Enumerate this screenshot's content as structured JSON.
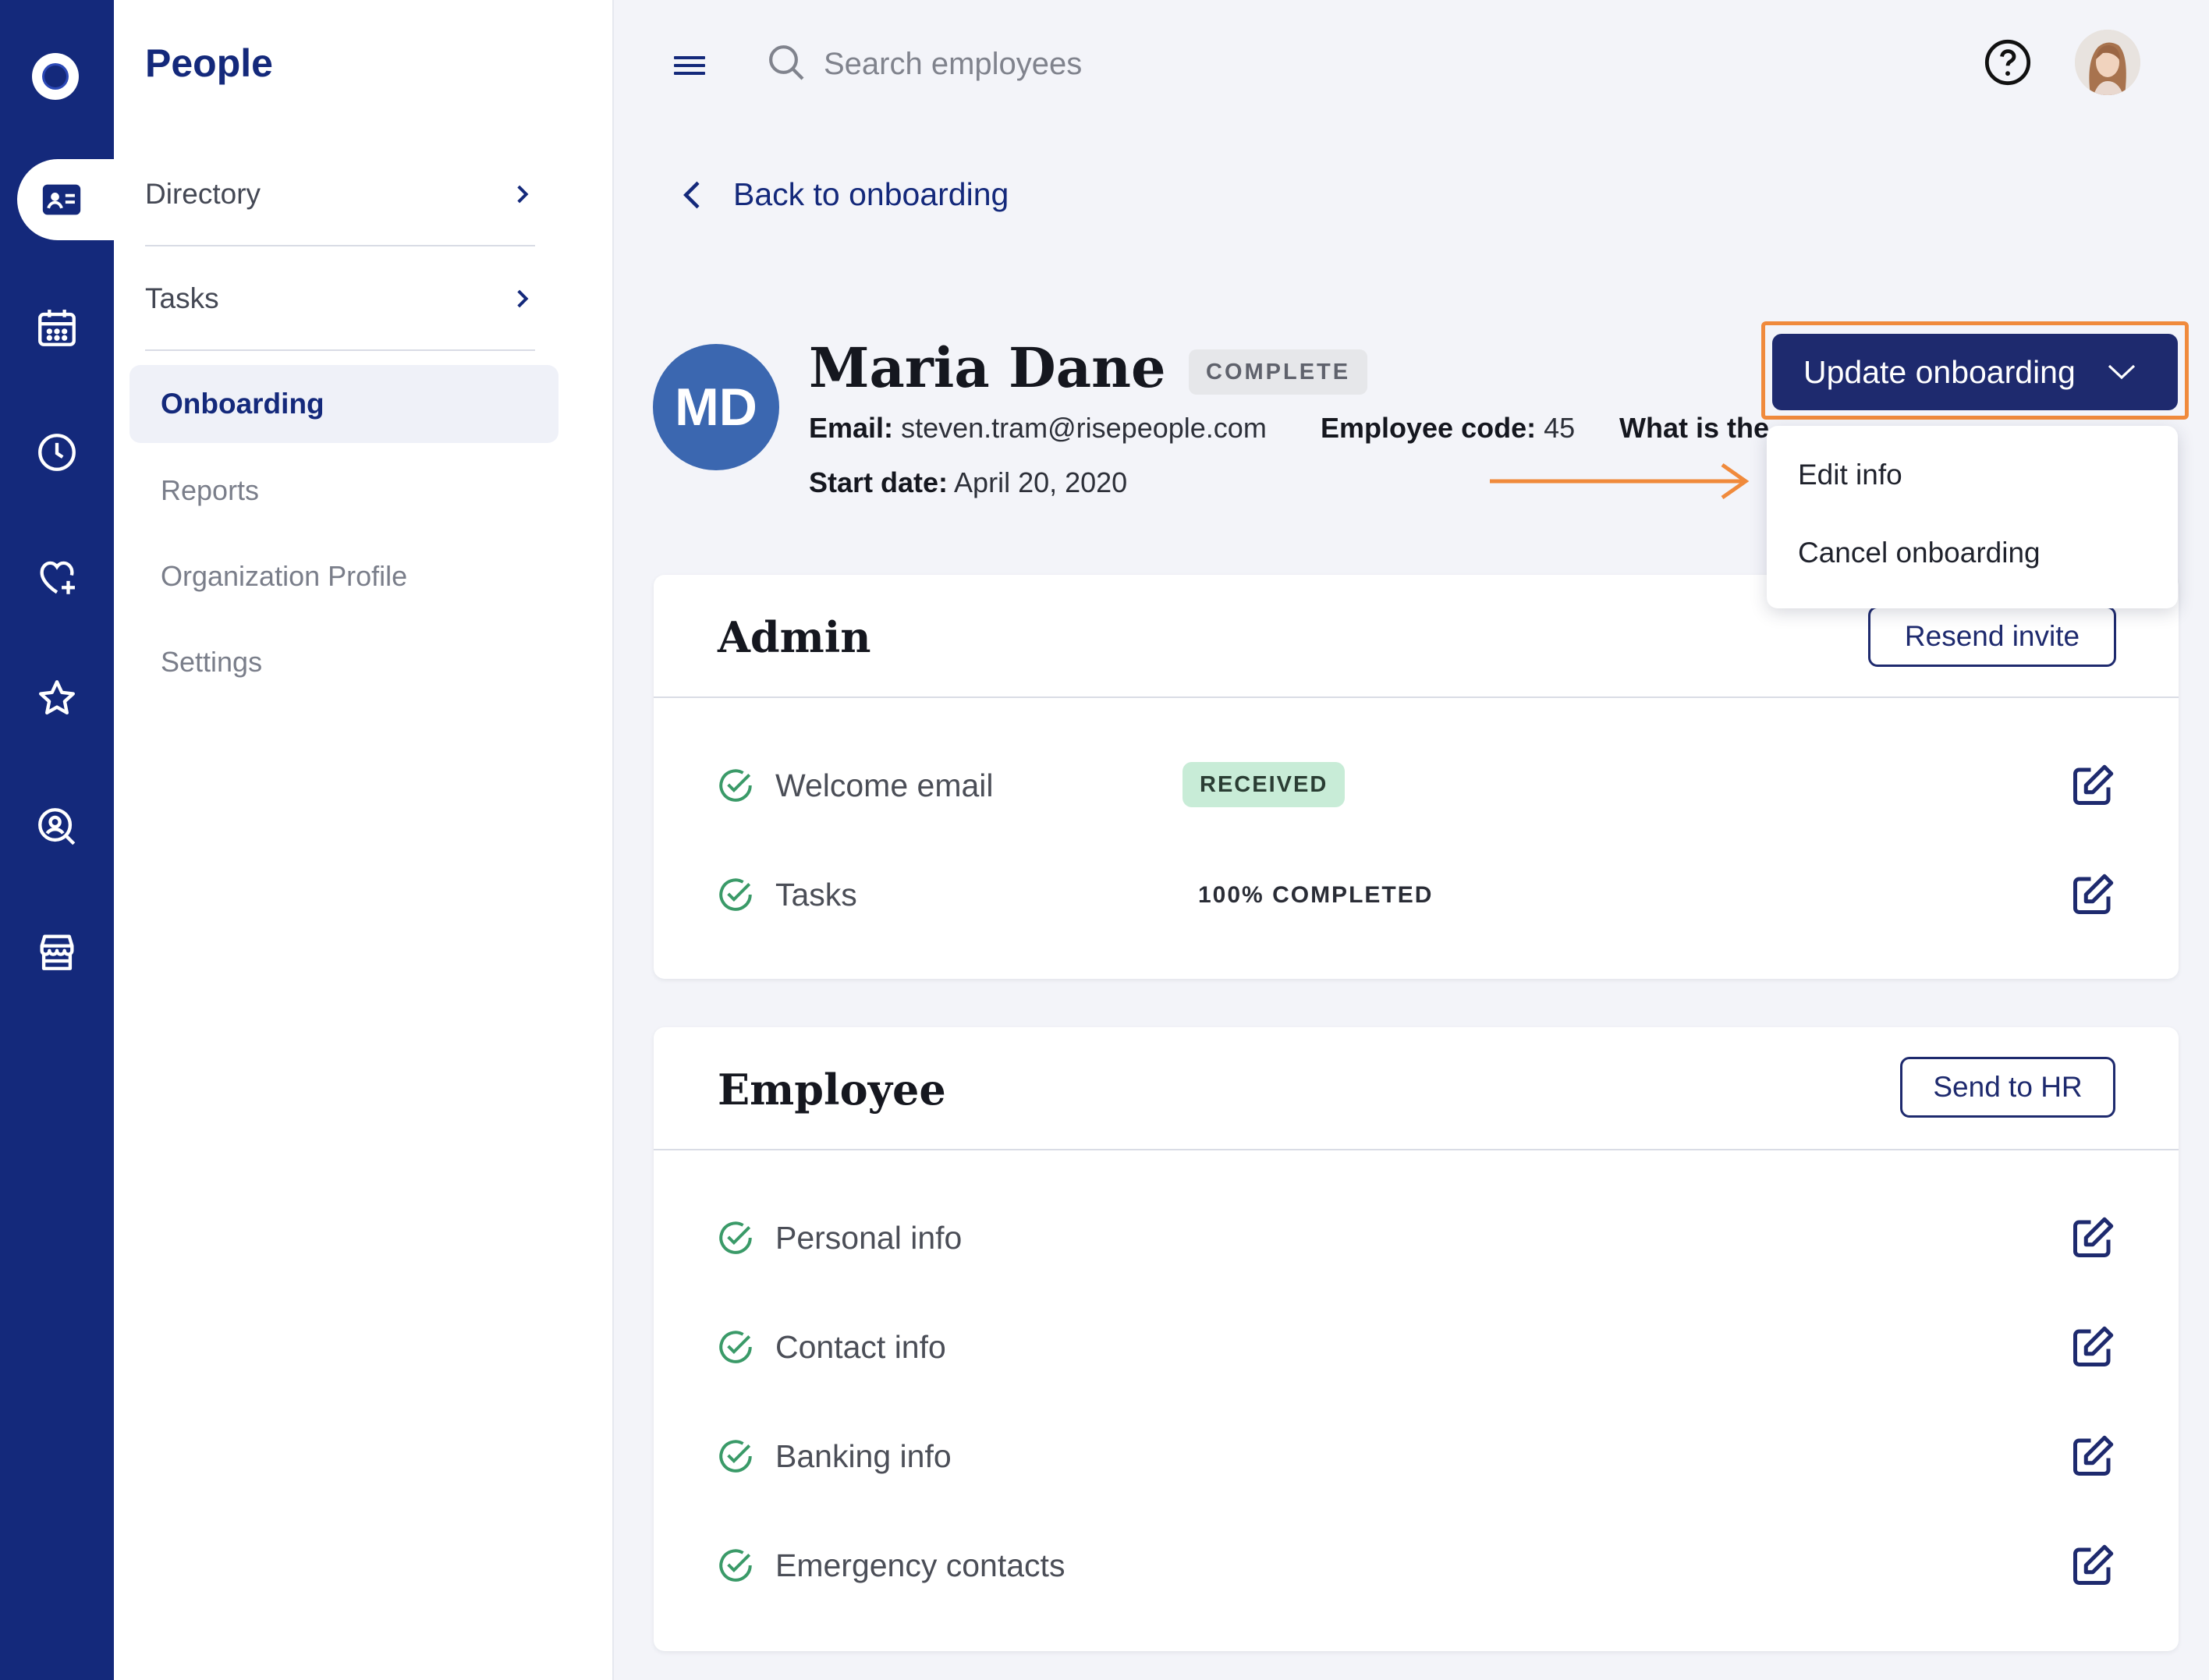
{
  "app": {
    "title": "People"
  },
  "rail": {
    "items": [
      "logo-icon",
      "directory-card-icon",
      "calendar-icon",
      "clock-icon",
      "heart-plus-icon",
      "star-icon",
      "person-search-icon",
      "store-icon"
    ]
  },
  "sidebar": {
    "nav": [
      {
        "label": "Directory"
      },
      {
        "label": "Tasks"
      }
    ],
    "subitems": [
      {
        "label": "Onboarding",
        "active": true
      },
      {
        "label": "Reports"
      },
      {
        "label": "Organization Profile"
      },
      {
        "label": "Settings"
      }
    ]
  },
  "topbar": {
    "search_placeholder": "Search employees"
  },
  "back_link": "Back to onboarding",
  "employee": {
    "initials": "MD",
    "name": "Maria Dane",
    "status": "COMPLETE",
    "email_label": "Email:",
    "email": "steven.tram@risepeople.com",
    "code_label": "Employee code:",
    "code": "45",
    "extra_label": "What is the",
    "start_label": "Start date:",
    "start_date": "April 20, 2020"
  },
  "update_button": {
    "label": "Update onboarding"
  },
  "dropdown": {
    "items": [
      "Edit info",
      "Cancel onboarding"
    ]
  },
  "admin_card": {
    "title": "Admin",
    "action": "Resend invite",
    "rows": [
      {
        "label": "Welcome email",
        "status": "RECEIVED"
      },
      {
        "label": "Tasks",
        "status": "100% COMPLETED"
      }
    ]
  },
  "employee_card": {
    "title": "Employee",
    "action": "Send to HR",
    "rows": [
      {
        "label": "Personal info"
      },
      {
        "label": "Contact info"
      },
      {
        "label": "Banking info"
      },
      {
        "label": "Emergency contacts"
      }
    ]
  },
  "colors": {
    "rail": "#14297b",
    "primary": "#1e2a6e",
    "highlight": "#f08a3c",
    "success": "#3a9a68",
    "received_bg": "#c8ecd7"
  }
}
